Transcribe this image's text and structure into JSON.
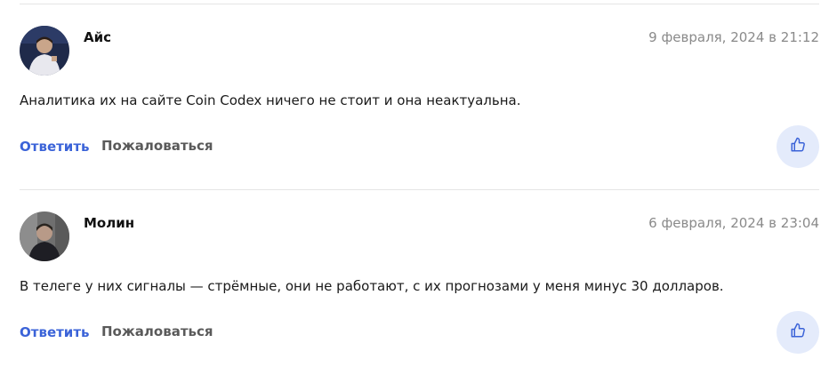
{
  "comments": [
    {
      "author": "Айс",
      "date": "9 февраля, 2024 в 21:12",
      "text": "Аналитика их на сайте Coin Codex ничего не стоит и она неактуальна.",
      "reply_label": "Ответить",
      "report_label": "Пожаловаться",
      "like_icon": "thumbs-up-icon"
    },
    {
      "author": "Молин",
      "date": "6 февраля, 2024 в 23:04",
      "text": "В телеге у них сигналы — стрёмные, они не работают, с их прогнозами у меня минус 30 долларов.",
      "reply_label": "Ответить",
      "report_label": "Пожаловаться",
      "like_icon": "thumbs-up-icon"
    }
  ],
  "colors": {
    "accent": "#3b63d8",
    "like_bg": "#e4ebfb",
    "muted": "#8a8a8a",
    "divider": "#e5e5e5"
  }
}
